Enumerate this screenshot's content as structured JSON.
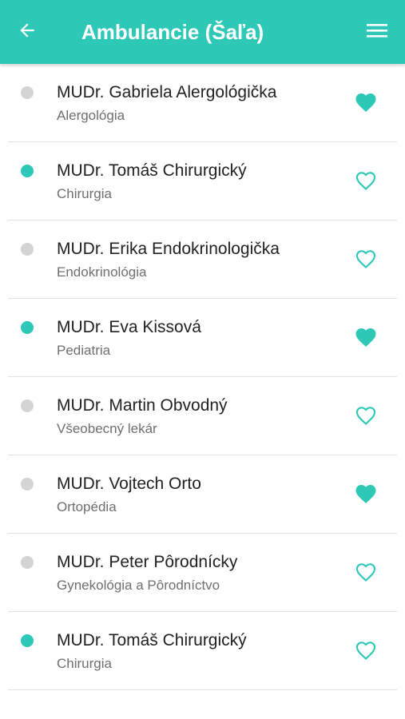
{
  "header": {
    "title": "Ambulancie (Šaľa)",
    "back_icon": "arrow-left-icon",
    "menu_icon": "hamburger-menu-icon",
    "background_color": "#2ec8b6"
  },
  "colors": {
    "accent": "#2ec8b6",
    "status_active": "#2ec8b6",
    "status_inactive": "#d4d4d4"
  },
  "doctors": [
    {
      "name": "MUDr. Gabriela Alergológička",
      "specialty": "Alergológia",
      "status": "inactive",
      "favorite": true
    },
    {
      "name": "MUDr. Tomáš Chirurgický",
      "specialty": "Chirurgia",
      "status": "active",
      "favorite": false
    },
    {
      "name": "MUDr. Erika Endokrinologička",
      "specialty": "Endokrinológia",
      "status": "inactive",
      "favorite": false
    },
    {
      "name": "MUDr. Eva Kissová",
      "specialty": "Pediatria",
      "status": "active",
      "favorite": true
    },
    {
      "name": "MUDr. Martin Obvodný",
      "specialty": "Všeobecný lekár",
      "status": "inactive",
      "favorite": false
    },
    {
      "name": "MUDr. Vojtech Orto",
      "specialty": "Ortopédia",
      "status": "inactive",
      "favorite": true
    },
    {
      "name": "MUDr. Peter Pôrodnícky",
      "specialty": "Gynekológia a Pôrodníctvo",
      "status": "inactive",
      "favorite": false
    },
    {
      "name": "MUDr. Tomáš Chirurgický",
      "specialty": "Chirurgia",
      "status": "active",
      "favorite": false
    }
  ]
}
